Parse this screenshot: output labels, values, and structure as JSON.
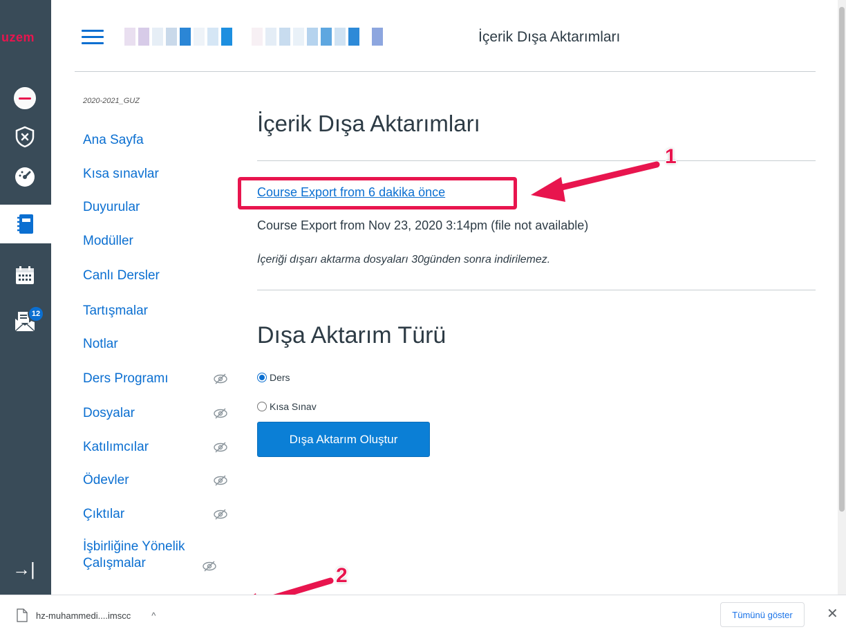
{
  "global_nav": {
    "logo_text": "uzem",
    "items": [
      {
        "icon": "account-avatar-icon"
      },
      {
        "icon": "admin-shield-icon"
      },
      {
        "icon": "dashboard-gauge-icon"
      },
      {
        "icon": "courses-notebook-icon",
        "active": true
      },
      {
        "icon": "calendar-icon"
      },
      {
        "icon": "inbox-icon",
        "badge": "12"
      }
    ],
    "collapse_icon": "→|"
  },
  "header": {
    "current_page": "İçerik Dışa Aktarımları"
  },
  "course_nav": {
    "term": "2020-2021_GUZ",
    "items": [
      {
        "label": "Ana Sayfa",
        "hidden": false
      },
      {
        "label": "Kısa sınavlar",
        "hidden": false
      },
      {
        "label": "Duyurular",
        "hidden": false
      },
      {
        "label": "Modüller",
        "hidden": false
      },
      {
        "label": "Canlı Dersler",
        "hidden": false
      },
      {
        "label": "Tartışmalar",
        "hidden": false
      },
      {
        "label": "Notlar",
        "hidden": false
      },
      {
        "label": "Ders Programı",
        "hidden": true
      },
      {
        "label": "Dosyalar",
        "hidden": true
      },
      {
        "label": "Katılımcılar",
        "hidden": true
      },
      {
        "label": "Ödevler",
        "hidden": true
      },
      {
        "label": "Çıktılar",
        "hidden": true
      },
      {
        "label": "İşbirliğine Yönelik Çalışmalar",
        "hidden": true
      }
    ]
  },
  "main": {
    "heading": "İçerik Dışa Aktarımları",
    "export_link": "Course Export from 6 dakika önce",
    "export_old": "Course Export from Nov 23, 2020 3:14pm (file not available)",
    "note": "İçeriği dışarı aktarma dosyaları 30günden sonra indirilemez.",
    "export_type_heading": "Dışa Aktarım Türü",
    "options": [
      {
        "label": "Ders",
        "checked": true
      },
      {
        "label": "Kısa Sınav",
        "checked": false
      }
    ],
    "create_button": "Dışa Aktarım Oluştur"
  },
  "annotations": {
    "callout_1": "1",
    "callout_2": "2",
    "color": "#e8154e"
  },
  "download_shelf": {
    "filename": "hz-muhammedi....imscc",
    "chevron": "^",
    "show_all": "Tümünü göster",
    "close": "✕"
  },
  "colors": {
    "nav_bg": "#394b58",
    "link": "#0b6fd1",
    "button": "#0b7fd6",
    "text": "#2d3b45"
  }
}
